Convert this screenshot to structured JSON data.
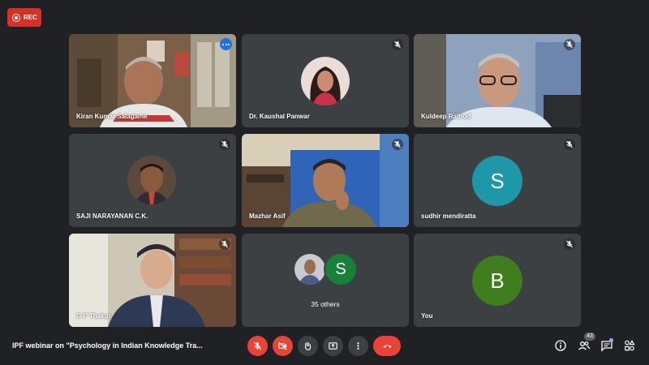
{
  "recording": {
    "label": "REC"
  },
  "participants": [
    {
      "name": "Kiran Kumar Salagame",
      "type": "video",
      "active_speaker": true
    },
    {
      "name": "Dr. Kaushal Panwar",
      "type": "photo",
      "muted": true
    },
    {
      "name": "Kuldeep Rathod",
      "type": "video",
      "muted": true
    },
    {
      "name": "SAJI NARAYANAN C.K.",
      "type": "photo",
      "muted": true
    },
    {
      "name": "Mazhar Asif",
      "type": "video",
      "muted": true
    },
    {
      "name": "sudhir mendiratta",
      "type": "initial",
      "initial": "S",
      "color": "#1e98a8",
      "muted": true
    },
    {
      "name": "G P Thakur",
      "type": "video",
      "muted": true
    },
    {
      "name": "",
      "type": "others",
      "label": "35 others",
      "initial": "S",
      "color": "#188038"
    },
    {
      "name": "You",
      "type": "initial",
      "initial": "B",
      "color": "#3f7d1e",
      "muted": true
    }
  ],
  "meeting": {
    "title": "IPF webinar on \"Psychology in Indian Knowledge Tra..."
  },
  "controls": {
    "mic": "mic-off-icon",
    "camera": "camera-off-icon",
    "raise_hand": "raise-hand-icon",
    "present": "present-screen-icon",
    "more": "more-options-icon",
    "end_call": "end-call-icon"
  },
  "right_panel": {
    "participant_count": "43"
  },
  "colors": {
    "background": "#202124",
    "tile": "#3c4043",
    "accent": "#8ab4f8",
    "danger": "#ea4335"
  }
}
